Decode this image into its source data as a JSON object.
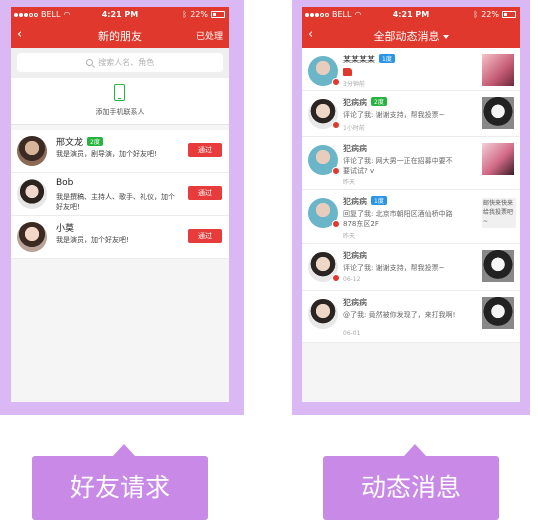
{
  "status": {
    "carrier": "BELL",
    "time": "4:21 PM",
    "battery": "22%"
  },
  "left_screen": {
    "nav": {
      "back_icon": "chevron-left-icon",
      "title": "新的朋友",
      "right": "已处理"
    },
    "search": {
      "placeholder": "搜索人名、角色"
    },
    "add_contacts": "添加手机联系人",
    "requests": [
      {
        "name": "邢文龙",
        "badge": "2度",
        "desc": "我是演员，剧导演，加个好友吧!",
        "button": "通过"
      },
      {
        "name": "Bob",
        "badge": "",
        "desc": "我是撰稿、主持人、歌手、礼仪，加个好友吧!",
        "button": "通过"
      },
      {
        "name": "小莫",
        "badge": "",
        "desc": "我是演员，加个好友吧!",
        "button": "通过"
      }
    ]
  },
  "right_screen": {
    "nav": {
      "back_icon": "chevron-left-icon",
      "title": "全部动态消息"
    },
    "feed": [
      {
        "name": "某某某某",
        "badge": "1度",
        "badge_color": "#2a95e8",
        "text": "",
        "time": "3分钟前",
        "thumb_text": ""
      },
      {
        "name": "犯病病",
        "badge": "2度",
        "badge_color": "#27b33f",
        "text": "评论了我: 谢谢支持，帮我投票~",
        "time": "1小时前",
        "thumb_text": ""
      },
      {
        "name": "犯病病",
        "badge": "",
        "badge_color": "",
        "text": "评论了我: 网大男一正在招募中要不要试试? v",
        "time": "昨天",
        "thumb_text": ""
      },
      {
        "name": "犯病病",
        "badge": "1度",
        "badge_color": "#2a95e8",
        "text": "回复了我: 北京市朝阳区酒仙桥中路878东区2F",
        "time": "昨天",
        "thumb_text": "邮快来快来给我投票吧~"
      },
      {
        "name": "犯病病",
        "badge": "",
        "badge_color": "",
        "text": "评论了我: 谢谢支持，帮我投票~",
        "time": "06-12",
        "thumb_text": ""
      },
      {
        "name": "犯病病",
        "badge": "",
        "badge_color": "",
        "text": "@了我: 竟然被你发现了，来打我啊!",
        "time": "06-01",
        "thumb_text": ""
      }
    ]
  },
  "labels": {
    "left": "好友请求",
    "right": "动态消息"
  },
  "colors": {
    "accent": "#e0382c",
    "frame": "#d9b8f3",
    "tag": "#c88ae6"
  }
}
